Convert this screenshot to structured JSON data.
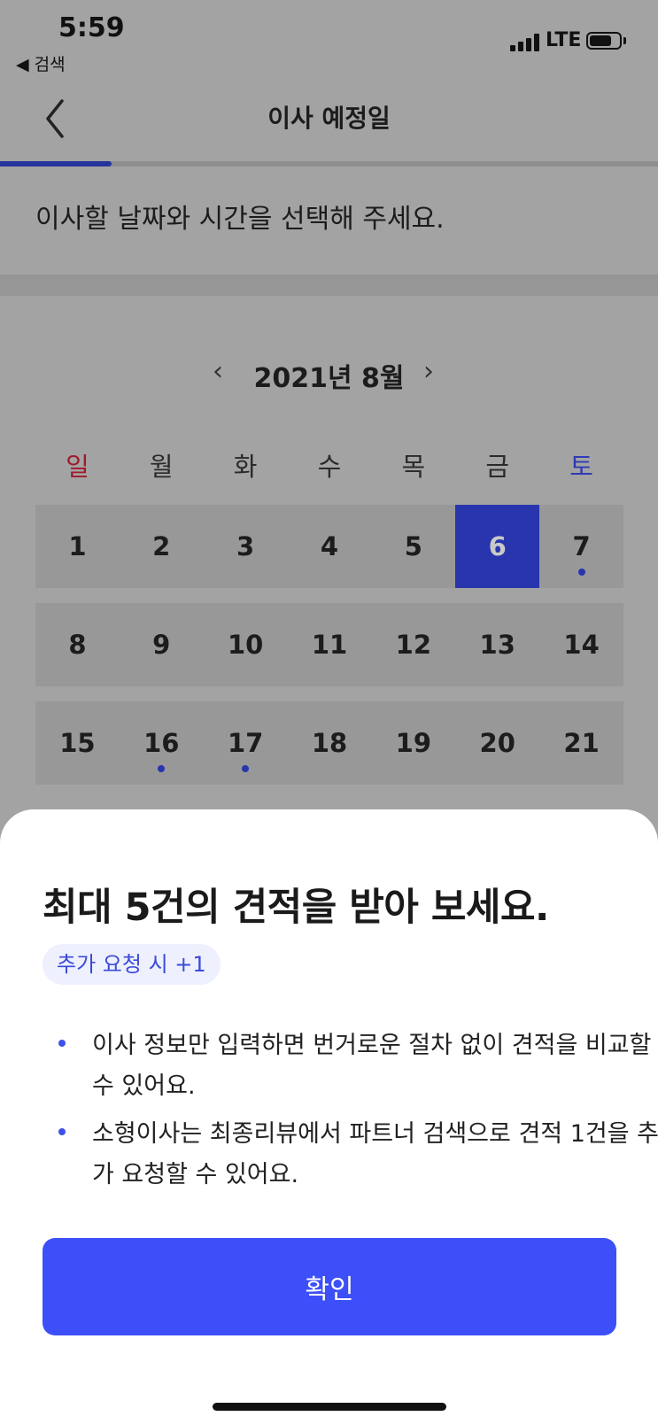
{
  "status_bar": {
    "time": "5:59",
    "back_app": "◀ 검색",
    "network": "LTE"
  },
  "header": {
    "title": "이사 예정일",
    "back_icon": "chevron-left-icon"
  },
  "progress": {
    "fraction": 0.17,
    "color": "#27339c"
  },
  "instruction": "이사할 날짜와 시간을 선택해 주세요.",
  "calendar": {
    "month_label": "2021년 8월",
    "prev_icon": "‹",
    "next_icon": "›",
    "weekdays": [
      "일",
      "월",
      "화",
      "수",
      "목",
      "금",
      "토"
    ],
    "weeks": [
      [
        {
          "d": "1"
        },
        {
          "d": "2"
        },
        {
          "d": "3"
        },
        {
          "d": "4"
        },
        {
          "d": "5"
        },
        {
          "d": "6",
          "selected": true
        },
        {
          "d": "7",
          "dot": true
        }
      ],
      [
        {
          "d": "8"
        },
        {
          "d": "9"
        },
        {
          "d": "10"
        },
        {
          "d": "11"
        },
        {
          "d": "12"
        },
        {
          "d": "13"
        },
        {
          "d": "14"
        }
      ],
      [
        {
          "d": "15"
        },
        {
          "d": "16",
          "dot": true
        },
        {
          "d": "17",
          "dot": true
        },
        {
          "d": "18"
        },
        {
          "d": "19"
        },
        {
          "d": "20"
        },
        {
          "d": "21"
        }
      ]
    ],
    "selected_color": "#2835ad"
  },
  "sheet": {
    "title": "최대 5건의 견적을 받아 보세요.",
    "badge": "추가 요청 시 +1",
    "bullets": [
      "이사 정보만 입력하면 번거로운 절차 없이 견적을 비교할 수 있어요.",
      "소형이사는 최종리뷰에서 파트너 검색으로 견적 1건을 추가 요청할 수 있어요."
    ],
    "confirm_label": "확인",
    "accent_color": "#3d4ff8"
  }
}
